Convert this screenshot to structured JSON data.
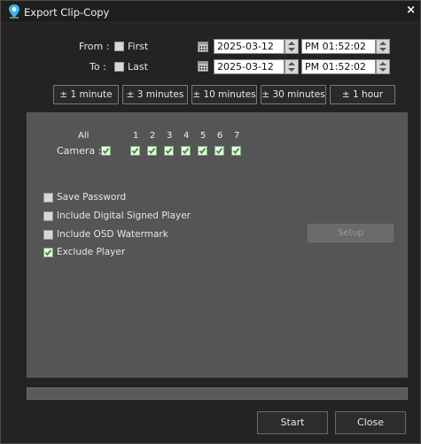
{
  "window": {
    "title": "Export Clip-Copy",
    "close_glyph": "×"
  },
  "range": {
    "from": {
      "label": "From :",
      "option_label": "First",
      "option_checked": false,
      "date": "2025-03-12",
      "time": "PM 01:52:02"
    },
    "to": {
      "label": "To :",
      "option_label": "Last",
      "option_checked": false,
      "date": "2025-03-12",
      "time": "PM 01:52:02"
    }
  },
  "quick_buttons": [
    "± 1 minute",
    "± 3 minutes",
    "± 10 minutes",
    "± 30 minutes",
    "± 1 hour"
  ],
  "cameras": {
    "label": "Camera :",
    "all_label": "All",
    "all_checked": true,
    "items": [
      {
        "num": "1",
        "checked": true
      },
      {
        "num": "2",
        "checked": true
      },
      {
        "num": "3",
        "checked": true
      },
      {
        "num": "4",
        "checked": true
      },
      {
        "num": "5",
        "checked": true
      },
      {
        "num": "6",
        "checked": true
      },
      {
        "num": "7",
        "checked": true
      }
    ]
  },
  "options": [
    {
      "label": "Save Password",
      "checked": false
    },
    {
      "label": "Include Digital Signed Player",
      "checked": false
    },
    {
      "label": "Include OSD Watermark",
      "checked": false
    },
    {
      "label": "Exclude Player",
      "checked": true
    }
  ],
  "setup_label": "Setup",
  "progress": 0,
  "actions": {
    "start_label": "Start",
    "close_label": "Close"
  },
  "colors": {
    "accent_green": "#4a9a3a",
    "panel": "#555555"
  },
  "icons": {
    "app": "map-pin-icon",
    "calendar": "calendar-icon",
    "spinner": "spin-updown-icon"
  }
}
